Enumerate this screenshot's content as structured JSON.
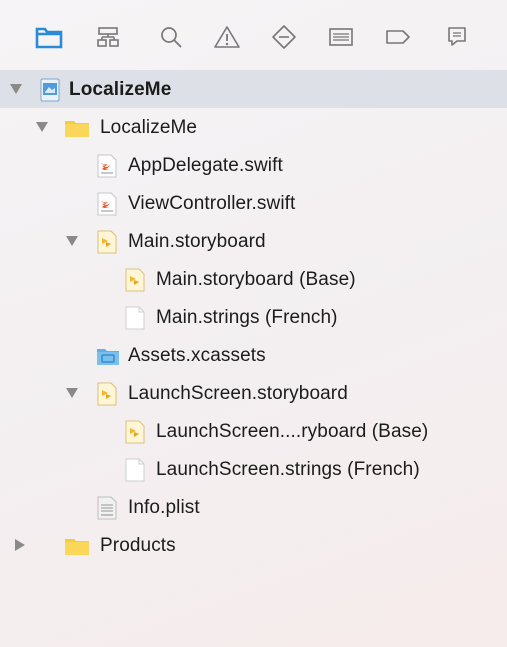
{
  "navigator_tabs": [
    {
      "icon": "folder-icon",
      "name": "project-navigator"
    },
    {
      "icon": "hierarchy-icon",
      "name": "symbol-navigator"
    },
    {
      "icon": "search-icon",
      "name": "find-navigator"
    },
    {
      "icon": "warning-icon",
      "name": "issue-navigator"
    },
    {
      "icon": "diamond-minus-icon",
      "name": "test-navigator"
    },
    {
      "icon": "list-icon",
      "name": "debug-navigator"
    },
    {
      "icon": "tag-icon",
      "name": "breakpoint-navigator"
    },
    {
      "icon": "speech-bubble-icon",
      "name": "report-navigator"
    }
  ],
  "accent_color": "#2a8cd6",
  "tree": {
    "project": "LocalizeMe",
    "group": "LocalizeMe",
    "app_delegate": "AppDelegate.swift",
    "view_controller": "ViewController.swift",
    "main_storyboard": "Main.storyboard",
    "main_storyboard_base": "Main.storyboard (Base)",
    "main_strings_french": "Main.strings (French)",
    "assets": "Assets.xcassets",
    "launch_storyboard": "LaunchScreen.storyboard",
    "launch_storyboard_base": "LaunchScreen....ryboard (Base)",
    "launch_strings_french": "LaunchScreen.strings (French)",
    "info_plist": "Info.plist",
    "products": "Products"
  }
}
